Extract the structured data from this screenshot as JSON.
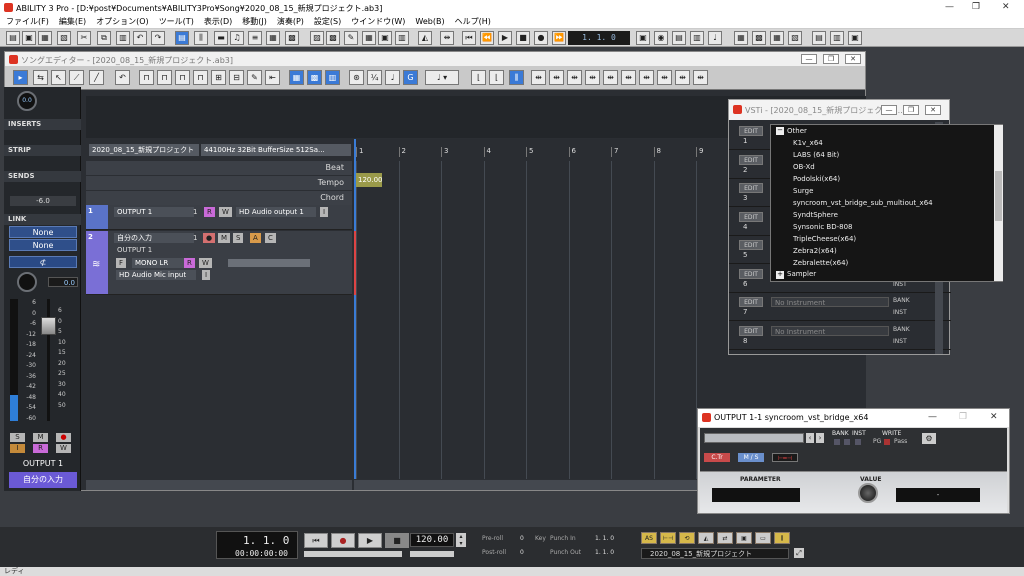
{
  "app": {
    "title": "ABILITY 3 Pro - [D:¥post¥Documents¥ABILITY3Pro¥Song¥2020_08_15_新規プロジェクト.ab3]",
    "window_controls": [
      "—",
      "❐",
      "✕"
    ]
  },
  "menu": [
    "ファイル(F)",
    "編集(E)",
    "オプション(O)",
    "ツール(T)",
    "表示(D)",
    "移動(J)",
    "演奏(P)",
    "設定(S)",
    "ウインドウ(W)",
    "Web(B)",
    "ヘルプ(H)"
  ],
  "toolbar": {
    "position": "1. 1. 0"
  },
  "song_editor": {
    "title": "ソングエディター - [2020_08_15_新規プロジェクト.ab3]",
    "project_name": "2020_08_15_新規プロジェクト",
    "audio_info": "44100Hz 32Bit BufferSize 512Sa...",
    "header_rows": [
      "Beat",
      "Tempo",
      "Chord"
    ],
    "tempo_value": "120.00",
    "ruler": [
      "1",
      "2",
      "3",
      "4",
      "5",
      "6",
      "7",
      "8",
      "9"
    ],
    "tracks": [
      {
        "num": "1",
        "name": "OUTPUT 1",
        "ch": "1",
        "r": "R",
        "w": "W",
        "output": "HD Audio output 1 1...",
        "i": "I"
      },
      {
        "num": "2",
        "name": "自分の入力",
        "ch": "1",
        "buttons": [
          "●",
          "M",
          "S",
          "A",
          "C"
        ],
        "sub": "OUTPUT 1",
        "f": "F",
        "mono": "MONO LR",
        "r": "R",
        "w": "W",
        "input": "HD Audio Mic input ...",
        "i": "I"
      }
    ]
  },
  "left_panel": {
    "volume_knob": "0.0",
    "sections": [
      "INSERTS",
      "STRIP",
      "SENDS",
      "LINK"
    ],
    "sends_value": "-6.0",
    "link_values": [
      "None",
      "None"
    ],
    "pan_value": "0.0",
    "fader_scale_left": [
      "6",
      "0",
      "-6",
      "-12",
      "-18",
      "-24",
      "-30",
      "-36",
      "-42",
      "-48",
      "-54",
      "-60"
    ],
    "fader_scale_right": [
      "6",
      "0",
      "5",
      "10",
      "15",
      "20",
      "25",
      "30",
      "40",
      "50"
    ],
    "sm_buttons": [
      "S",
      "M",
      "●",
      "I",
      "R",
      "W"
    ],
    "output_label": "OUTPUT 1",
    "input_label": "自分の入力"
  },
  "vsti": {
    "title": "VSTi - [2020_08_15_新規プロジェクト.a...",
    "slots": [
      {
        "edit": "EDIT",
        "num": "1"
      },
      {
        "edit": "EDIT",
        "num": "2"
      },
      {
        "edit": "EDIT",
        "num": "3"
      },
      {
        "edit": "EDIT",
        "num": "4"
      },
      {
        "edit": "EDIT",
        "num": "5"
      },
      {
        "edit": "EDIT",
        "num": "6",
        "inst_label": "INST"
      },
      {
        "edit": "EDIT",
        "num": "7",
        "placeholder": "No Instrument",
        "bank": "BANK",
        "inst_label": "INST"
      },
      {
        "edit": "EDIT",
        "num": "8",
        "placeholder": "No Instrument",
        "bank": "BANK",
        "inst_label": "INST"
      }
    ],
    "dropdown": {
      "group_other": "Other",
      "items": [
        "K1v_x64",
        "LABS (64 Bit)",
        "OB-Xd",
        "Podolski(x64)",
        "Surge",
        "syncroom_vst_bridge_sub_multiout_x64",
        "SyndtSphere",
        "Synsonic BD-808",
        "TripleCheese(x64)",
        "Zebra2(x64)",
        "Zebralette(x64)"
      ],
      "group_sampler": "Sampler"
    }
  },
  "output_plugin": {
    "title": "OUTPUT 1-1 syncroom_vst_bridge_x64",
    "labels": {
      "bank": "BANK",
      "inst": "INST",
      "write": "WRITE",
      "pg": "PG",
      "pass": "Pass"
    },
    "ctr": "C.Tr",
    "ms": "M / S",
    "parameter_label": "PARAMETER",
    "value_label": "VALUE",
    "value_display": "-"
  },
  "transport": {
    "position": "1. 1. 0",
    "time": "00:00:00:00",
    "tempo": "120.00",
    "preroll": "Pre-roll",
    "preroll_val": "0",
    "postroll": "Post-roll",
    "postroll_val": "0",
    "key": "Key",
    "punch_in": "Punch In",
    "punch_in_val": "1. 1. 0",
    "punch_out": "Punch Out",
    "punch_out_val": "1. 1. 0",
    "project": "2020_08_15_新規プロジェクト"
  },
  "status": "レディ"
}
